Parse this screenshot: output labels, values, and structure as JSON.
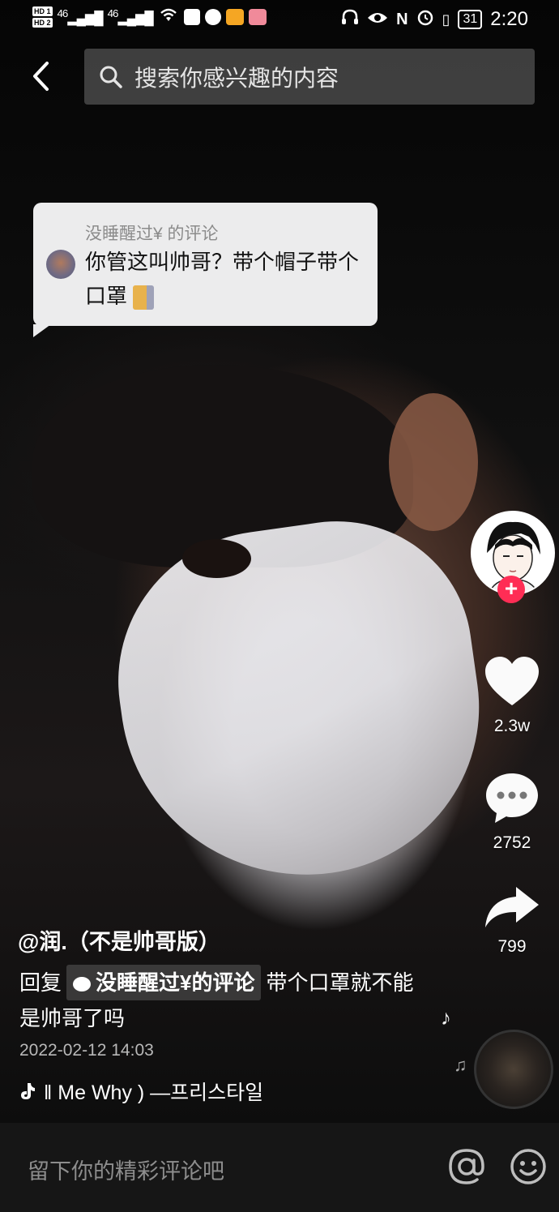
{
  "status_bar": {
    "hd1": "HD 1",
    "hd2": "HD 2",
    "signal1": "46",
    "signal2": "46",
    "battery": "31",
    "time": "2:20"
  },
  "search": {
    "placeholder": "搜索你感兴趣的内容"
  },
  "comment_bubble": {
    "author": "没睡醒过¥ 的评论",
    "text": "你管这叫帅哥？带个帽子带个口罩"
  },
  "actions": {
    "likes": "2.3w",
    "comments": "2752",
    "shares": "799"
  },
  "video": {
    "username": "@润.（不是帅哥版）",
    "reply_prefix": "回复",
    "reply_chip": "没睡醒过¥的评论",
    "reply_text": "带个口罩就不能是帅哥了吗",
    "date": "2022-02-12 14:03",
    "music": "‖ Me Why ) —프리스타일"
  },
  "comment_bar": {
    "placeholder": "留下你的精彩评论吧"
  },
  "colors": {
    "accent_follow": "#ff2d55",
    "bubble_bg": "#ececed"
  }
}
